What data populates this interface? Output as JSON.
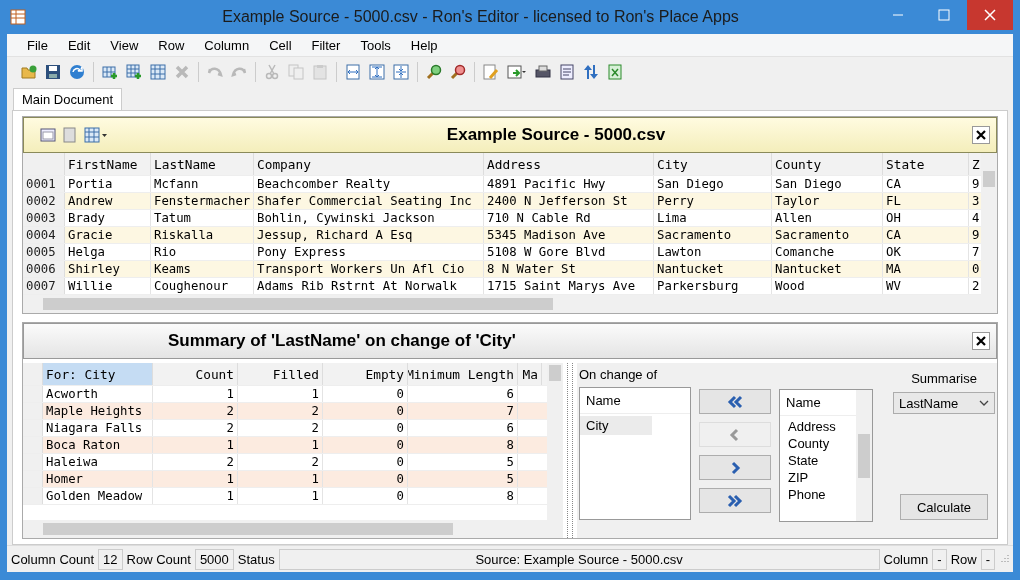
{
  "window": {
    "title": "Example Source - 5000.csv - Ron's Editor - licensed to Ron's Place Apps"
  },
  "menu": [
    "File",
    "Edit",
    "View",
    "Row",
    "Column",
    "Cell",
    "Filter",
    "Tools",
    "Help"
  ],
  "toolbar": [
    [
      {
        "kind": "open",
        "disabled": false
      },
      {
        "kind": "save",
        "disabled": false
      },
      {
        "kind": "refresh",
        "disabled": false
      }
    ],
    [
      {
        "kind": "add-row",
        "disabled": false
      },
      {
        "kind": "add-column",
        "disabled": false
      },
      {
        "kind": "grid",
        "disabled": false
      },
      {
        "kind": "delete",
        "disabled": true
      }
    ],
    [
      {
        "kind": "undo",
        "disabled": true
      },
      {
        "kind": "redo",
        "disabled": true
      }
    ],
    [
      {
        "kind": "cut",
        "disabled": true
      },
      {
        "kind": "copy",
        "disabled": true
      },
      {
        "kind": "paste",
        "disabled": true
      }
    ],
    [
      {
        "kind": "fit-width",
        "disabled": false
      },
      {
        "kind": "fit-all",
        "disabled": false
      },
      {
        "kind": "fit-height",
        "disabled": false
      }
    ],
    [
      {
        "kind": "zoom-in",
        "disabled": false
      },
      {
        "kind": "zoom-out",
        "disabled": false
      }
    ],
    [
      {
        "kind": "edit",
        "disabled": false
      },
      {
        "kind": "export",
        "disabled": false
      },
      {
        "kind": "print",
        "disabled": false
      },
      {
        "kind": "properties",
        "disabled": false
      },
      {
        "kind": "sort",
        "disabled": false
      },
      {
        "kind": "excel",
        "disabled": false
      }
    ]
  ],
  "tabs": [
    {
      "label": "Main Document",
      "selected": true
    }
  ],
  "document": {
    "title": "Example Source - 5000.csv",
    "columns": [
      "FirstName",
      "LastName",
      "Company",
      "Address",
      "City",
      "County",
      "State",
      "Z"
    ],
    "rows": [
      {
        "number": "0001",
        "cells": [
          "Portia",
          "Mcfann",
          "Beachcomber Realty",
          "4891 Pacific Hwy",
          "San Diego",
          "San Diego",
          "CA",
          "9"
        ]
      },
      {
        "number": "0002",
        "cells": [
          "Andrew",
          "Fenstermacher",
          "Shafer Commercial Seating Inc",
          "2400 N Jefferson St",
          "Perry",
          "Taylor",
          "FL",
          "3"
        ]
      },
      {
        "number": "0003",
        "cells": [
          "Brady",
          "Tatum",
          "Bohlin, Cywinski Jackson",
          "710 N Cable Rd",
          "Lima",
          "Allen",
          "OH",
          "4"
        ]
      },
      {
        "number": "0004",
        "cells": [
          "Gracie",
          "Riskalla",
          "Jessup, Richard A Esq",
          "5345 Madison Ave",
          "Sacramento",
          "Sacramento",
          "CA",
          "9"
        ]
      },
      {
        "number": "0005",
        "cells": [
          "Helga",
          "Rio",
          "Pony Express",
          "5108 W Gore Blvd",
          "Lawton",
          "Comanche",
          "OK",
          "7"
        ]
      },
      {
        "number": "0006",
        "cells": [
          "Shirley",
          "Keams",
          "Transport Workers Un Afl Cio",
          "8 N Water St",
          "Nantucket",
          "Nantucket",
          "MA",
          "0"
        ]
      },
      {
        "number": "0007",
        "cells": [
          "Willie",
          "Coughenour",
          "Adams Rib Rstrnt At Norwalk",
          "1715 Saint Marys Ave",
          "Parkersburg",
          "Wood",
          "WV",
          "2"
        ]
      }
    ]
  },
  "summary": {
    "title": "Summary of 'LastName' on change of 'City'",
    "columns": [
      {
        "label": "For: City",
        "selected": true
      },
      {
        "label": "Count",
        "selected": false
      },
      {
        "label": "Filled",
        "selected": false
      },
      {
        "label": "Empty",
        "selected": false
      },
      {
        "label": "Minimum Length",
        "selected": false
      },
      {
        "label": "Ma",
        "selected": false
      }
    ],
    "rows": [
      [
        "Acworth",
        "1",
        "1",
        "0",
        "6"
      ],
      [
        "Maple Heights",
        "2",
        "2",
        "0",
        "7"
      ],
      [
        "Niagara Falls",
        "2",
        "2",
        "0",
        "6"
      ],
      [
        "Boca Raton",
        "1",
        "1",
        "0",
        "8"
      ],
      [
        "Haleiwa",
        "2",
        "2",
        "0",
        "5"
      ],
      [
        "Homer",
        "1",
        "1",
        "0",
        "5"
      ],
      [
        "Golden Meadow",
        "1",
        "1",
        "0",
        "8"
      ]
    ],
    "on_change_label": "On change of",
    "selected_list": {
      "header": "Name",
      "items": [
        {
          "label": "City",
          "selected": true
        }
      ]
    },
    "move_buttons": [
      {
        "kind": "remove-all",
        "disabled": false
      },
      {
        "kind": "remove",
        "disabled": true
      },
      {
        "kind": "add",
        "disabled": false
      },
      {
        "kind": "add-all",
        "disabled": false
      }
    ],
    "available_list": {
      "header": "Name",
      "items": [
        {
          "label": "Address",
          "selected": false
        },
        {
          "label": "County",
          "selected": false
        },
        {
          "label": "State",
          "selected": false
        },
        {
          "label": "ZIP",
          "selected": false
        },
        {
          "label": "Phone",
          "selected": false
        }
      ]
    },
    "summarise": {
      "label": "Summarise",
      "value": "LastName"
    },
    "calculate": "Calculate"
  },
  "status_bar": [
    {
      "kind": "label",
      "text": "Column Count"
    },
    {
      "kind": "value",
      "text": "12"
    },
    {
      "kind": "label",
      "text": "Row Count"
    },
    {
      "kind": "value",
      "text": "5000"
    },
    {
      "kind": "label",
      "text": "Status"
    },
    {
      "kind": "wide",
      "text": "Source: Example Source - 5000.csv"
    },
    {
      "kind": "label",
      "text": "Column"
    },
    {
      "kind": "value",
      "text": "-"
    },
    {
      "kind": "label",
      "text": "Row"
    },
    {
      "kind": "value",
      "text": "-"
    }
  ]
}
